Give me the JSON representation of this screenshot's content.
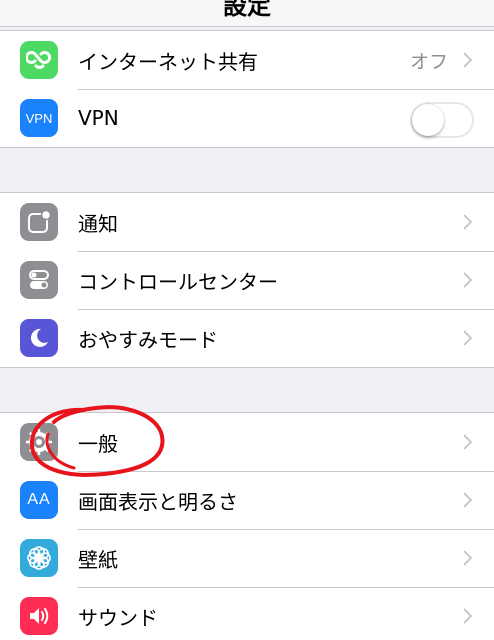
{
  "navbar": {
    "title": "設定"
  },
  "group1": {
    "items": [
      {
        "label": "インターネット共有",
        "detail": "オフ",
        "icon": "personal-hotspot-icon",
        "color": "#4cd964"
      },
      {
        "label": "VPN",
        "icon": "vpn-icon",
        "icon_text": "VPN",
        "color": "#1a82fb",
        "toggle": "off"
      }
    ]
  },
  "group2": {
    "items": [
      {
        "label": "通知",
        "icon": "notifications-icon",
        "color": "#8e8e93"
      },
      {
        "label": "コントロールセンター",
        "icon": "control-center-icon",
        "color": "#8e8e93"
      },
      {
        "label": "おやすみモード",
        "icon": "do-not-disturb-icon",
        "color": "#5856d6"
      }
    ]
  },
  "group3": {
    "items": [
      {
        "label": "一般",
        "icon": "gear-icon",
        "color": "#8e8e93"
      },
      {
        "label": "画面表示と明るさ",
        "icon": "display-brightness-icon",
        "icon_text": "AA",
        "color": "#1a82fb"
      },
      {
        "label": "壁紙",
        "icon": "wallpaper-icon",
        "color": "#34aadc"
      },
      {
        "label": "サウンド",
        "icon": "sounds-icon",
        "color": "#ff2d55"
      }
    ]
  }
}
